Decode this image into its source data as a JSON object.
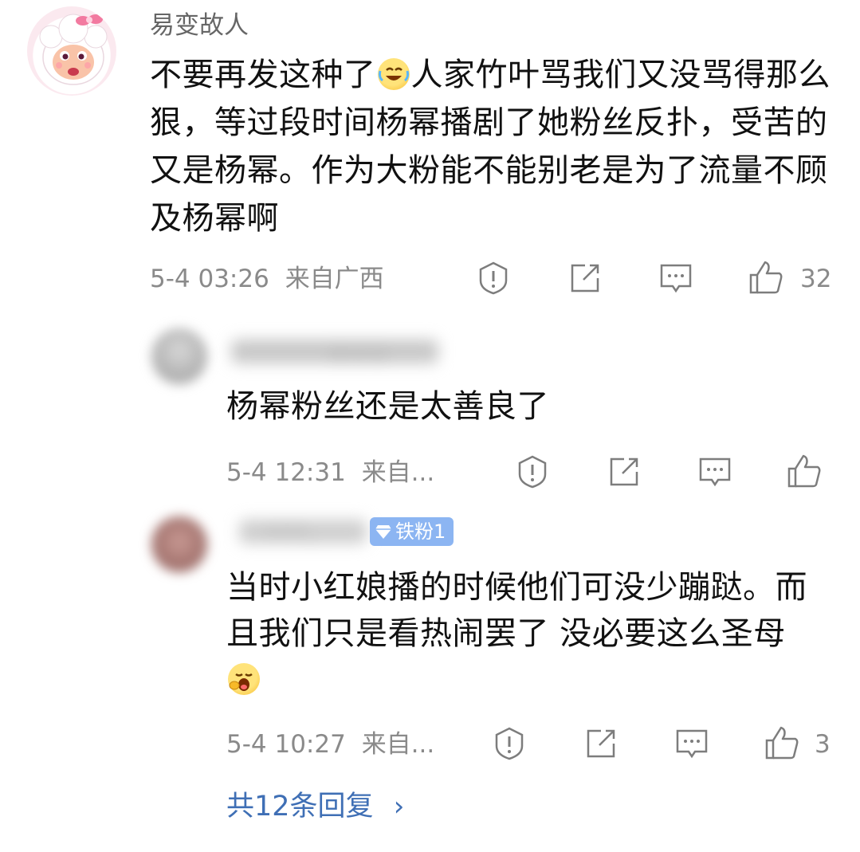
{
  "main_comment": {
    "username": "易变故人",
    "text_before_emoji": "不要再发这种了",
    "text_after_emoji": "人家竹叶骂我们又没骂得那么狠，等过段时间杨幂播剧了她粉丝反扑，受苦的又是杨幂。作为大粉能不能别老是为了流量不顾及杨幂啊",
    "time": "5-4 03:26",
    "location": "来自广西",
    "like_count": "32"
  },
  "replies": [
    {
      "username_blurred": "清凉该",
      "text": "杨幂粉丝还是太善良了",
      "time": "5-4 12:31",
      "location": "来自...",
      "like_count": ""
    },
    {
      "username_blurred": "mini_",
      "badge": "铁粉1",
      "text_before_emoji": "当时小红娘播的时候他们可没少蹦跶。而且我们只是看热闹罢了 没必要这么圣母",
      "time": "5-4 10:27",
      "location": "来自...",
      "like_count": "3"
    }
  ],
  "more_replies": {
    "label": "共12条回复",
    "chevron": "›"
  },
  "icons": {
    "report": "report-icon",
    "share": "share-icon",
    "comment": "comment-icon",
    "like": "thumbs-up-icon"
  }
}
